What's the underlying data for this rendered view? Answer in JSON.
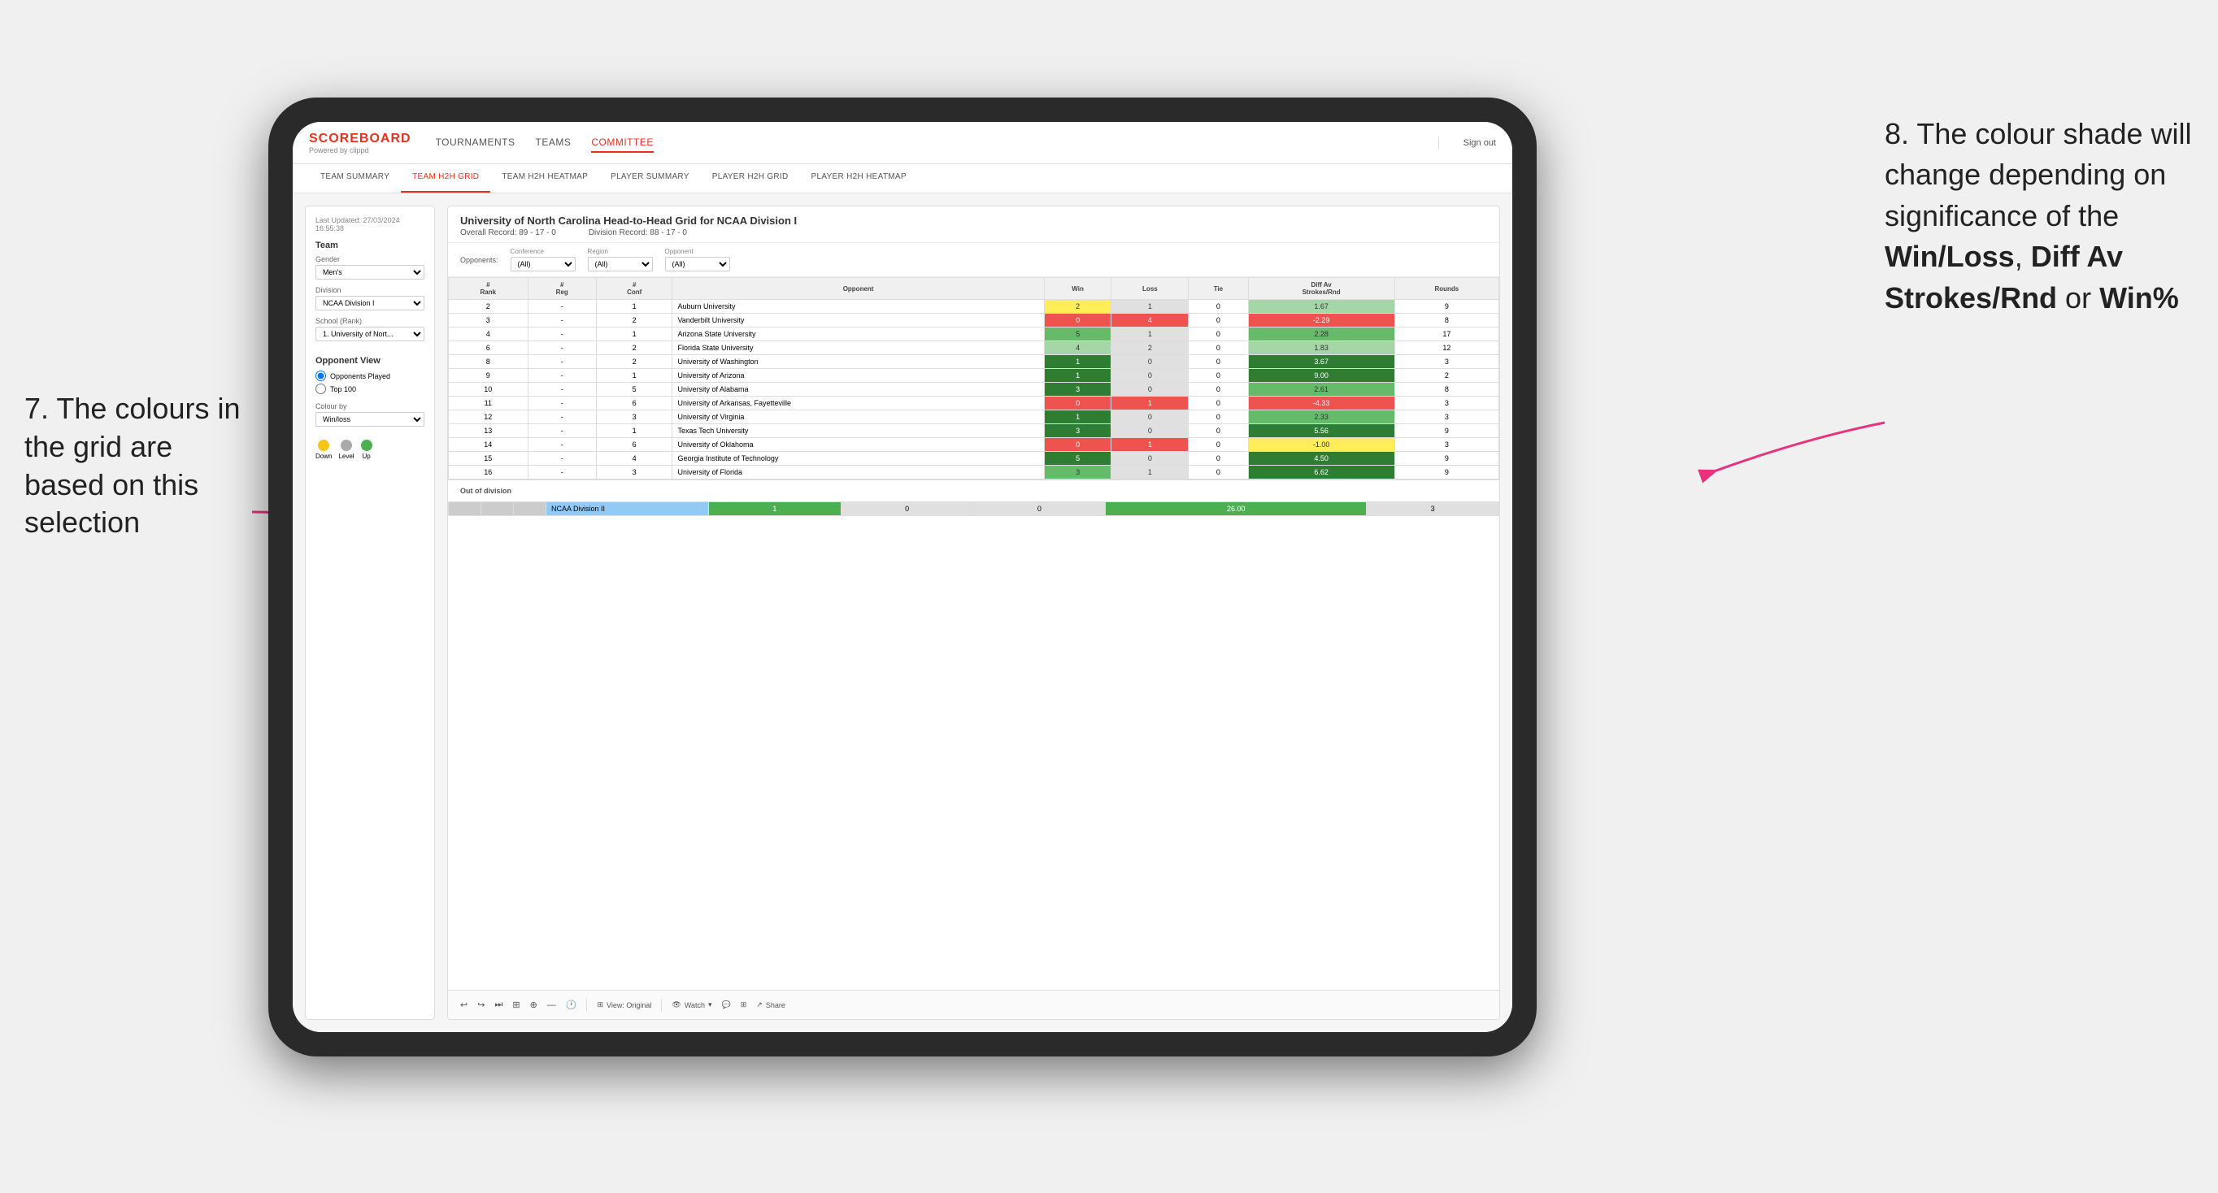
{
  "annotations": {
    "left_title": "7. The colours in the grid are based on this selection",
    "right_title": "8. The colour shade will change depending on significance of the ",
    "right_bold1": "Win/Loss",
    "right_sep1": ", ",
    "right_bold2": "Diff Av Strokes/Rnd",
    "right_sep2": " or ",
    "right_bold3": "Win%"
  },
  "header": {
    "logo": "SCOREBOARD",
    "logo_sub": "Powered by clippd",
    "nav": [
      "TOURNAMENTS",
      "TEAMS",
      "COMMITTEE"
    ],
    "active_nav": "COMMITTEE",
    "sign_out": "Sign out"
  },
  "sub_nav": {
    "items": [
      "TEAM SUMMARY",
      "TEAM H2H GRID",
      "TEAM H2H HEATMAP",
      "PLAYER SUMMARY",
      "PLAYER H2H GRID",
      "PLAYER H2H HEATMAP"
    ],
    "active": "TEAM H2H GRID"
  },
  "sidebar": {
    "last_updated": "Last Updated: 27/03/2024 16:55:38",
    "team_label": "Team",
    "gender_label": "Gender",
    "gender_value": "Men's",
    "division_label": "Division",
    "division_value": "NCAA Division I",
    "school_label": "School (Rank)",
    "school_value": "1. University of Nort...",
    "opponent_view_label": "Opponent View",
    "opponent_view_options": [
      "Opponents Played",
      "Top 100"
    ],
    "colour_by_label": "Colour by",
    "colour_by_value": "Win/loss",
    "legend": [
      {
        "color": "#f5c518",
        "label": "Down"
      },
      {
        "color": "#aaa",
        "label": "Level"
      },
      {
        "color": "#4caf50",
        "label": "Up"
      }
    ]
  },
  "grid": {
    "title": "University of North Carolina Head-to-Head Grid for NCAA Division I",
    "overall_record": "Overall Record: 89 - 17 - 0",
    "division_record": "Division Record: 88 - 17 - 0",
    "filters": {
      "opponents_label": "Opponents:",
      "opponents_value": "(All)",
      "conference_label": "Conference",
      "conference_value": "(All)",
      "region_label": "Region",
      "region_value": "(All)",
      "opponent_label": "Opponent",
      "opponent_value": "(All)"
    },
    "columns": [
      "#\nRank",
      "#\nReg",
      "#\nConf",
      "Opponent",
      "Win",
      "Loss",
      "Tie",
      "Diff Av\nStrokes/Rnd",
      "Rounds"
    ],
    "rows": [
      {
        "rank": "2",
        "reg": "-",
        "conf": "1",
        "opponent": "Auburn University",
        "win": "2",
        "loss": "1",
        "tie": "0",
        "diff": "1.67",
        "rounds": "9",
        "win_color": "yellow",
        "diff_color": "green-light"
      },
      {
        "rank": "3",
        "reg": "-",
        "conf": "2",
        "opponent": "Vanderbilt University",
        "win": "0",
        "loss": "4",
        "tie": "0",
        "diff": "-2.29",
        "rounds": "8",
        "win_color": "red",
        "diff_color": "red"
      },
      {
        "rank": "4",
        "reg": "-",
        "conf": "1",
        "opponent": "Arizona State University",
        "win": "5",
        "loss": "1",
        "tie": "0",
        "diff": "2.28",
        "rounds": "17",
        "win_color": "green-mid",
        "diff_color": "green-mid"
      },
      {
        "rank": "6",
        "reg": "-",
        "conf": "2",
        "opponent": "Florida State University",
        "win": "4",
        "loss": "2",
        "tie": "0",
        "diff": "1.83",
        "rounds": "12",
        "win_color": "green-light",
        "diff_color": "green-light"
      },
      {
        "rank": "8",
        "reg": "-",
        "conf": "2",
        "opponent": "University of Washington",
        "win": "1",
        "loss": "0",
        "tie": "0",
        "diff": "3.67",
        "rounds": "3",
        "win_color": "green-dark",
        "diff_color": "green-dark"
      },
      {
        "rank": "9",
        "reg": "-",
        "conf": "1",
        "opponent": "University of Arizona",
        "win": "1",
        "loss": "0",
        "tie": "0",
        "diff": "9.00",
        "rounds": "2",
        "win_color": "green-dark",
        "diff_color": "green-dark"
      },
      {
        "rank": "10",
        "reg": "-",
        "conf": "5",
        "opponent": "University of Alabama",
        "win": "3",
        "loss": "0",
        "tie": "0",
        "diff": "2.61",
        "rounds": "8",
        "win_color": "green-dark",
        "diff_color": "green-mid"
      },
      {
        "rank": "11",
        "reg": "-",
        "conf": "6",
        "opponent": "University of Arkansas, Fayetteville",
        "win": "0",
        "loss": "1",
        "tie": "0",
        "diff": "-4.33",
        "rounds": "3",
        "win_color": "red",
        "diff_color": "red"
      },
      {
        "rank": "12",
        "reg": "-",
        "conf": "3",
        "opponent": "University of Virginia",
        "win": "1",
        "loss": "0",
        "tie": "0",
        "diff": "2.33",
        "rounds": "3",
        "win_color": "green-dark",
        "diff_color": "green-mid"
      },
      {
        "rank": "13",
        "reg": "-",
        "conf": "1",
        "opponent": "Texas Tech University",
        "win": "3",
        "loss": "0",
        "tie": "0",
        "diff": "5.56",
        "rounds": "9",
        "win_color": "green-dark",
        "diff_color": "green-dark"
      },
      {
        "rank": "14",
        "reg": "-",
        "conf": "6",
        "opponent": "University of Oklahoma",
        "win": "0",
        "loss": "1",
        "tie": "0",
        "diff": "-1.00",
        "rounds": "3",
        "win_color": "red",
        "diff_color": "yellow"
      },
      {
        "rank": "15",
        "reg": "-",
        "conf": "4",
        "opponent": "Georgia Institute of Technology",
        "win": "5",
        "loss": "0",
        "tie": "0",
        "diff": "4.50",
        "rounds": "9",
        "win_color": "green-dark",
        "diff_color": "green-dark"
      },
      {
        "rank": "16",
        "reg": "-",
        "conf": "3",
        "opponent": "University of Florida",
        "win": "3",
        "loss": "1",
        "tie": "0",
        "diff": "6.62",
        "rounds": "9",
        "win_color": "green-mid",
        "diff_color": "green-dark"
      }
    ],
    "out_of_division_label": "Out of division",
    "out_of_division_row": {
      "name": "NCAA Division II",
      "win": "1",
      "loss": "0",
      "tie": "0",
      "diff": "26.00",
      "rounds": "3"
    }
  },
  "toolbar": {
    "view_label": "View: Original",
    "watch_label": "Watch",
    "share_label": "Share"
  }
}
